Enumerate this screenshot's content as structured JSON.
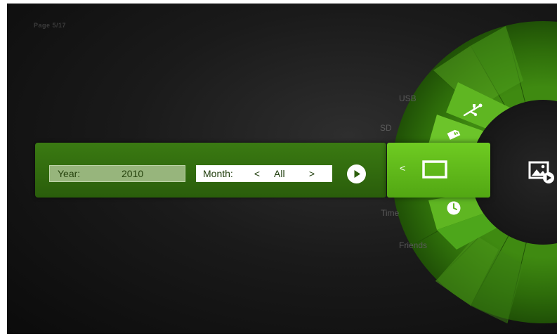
{
  "page_indicator": "Page 5/17",
  "categories": {
    "usb": "USB",
    "sd": "SD",
    "time": "Time",
    "friends": "Friends"
  },
  "filter": {
    "year_label": "Year:",
    "year_value": "2010",
    "month_label": "Month:",
    "month_prev": "<",
    "month_value": "All",
    "month_next": ">"
  },
  "selected_tile": {
    "back_label": "<"
  },
  "icons": {
    "usb": "usb-icon",
    "sd": "sd-card-icon",
    "time": "clock-icon",
    "selected": "screen-icon",
    "play": "play-icon",
    "photo": "photo-slideshow-icon"
  },
  "colors": {
    "accent": "#5fbc1a",
    "panel": "#2f6a0e",
    "background": "#151515"
  }
}
